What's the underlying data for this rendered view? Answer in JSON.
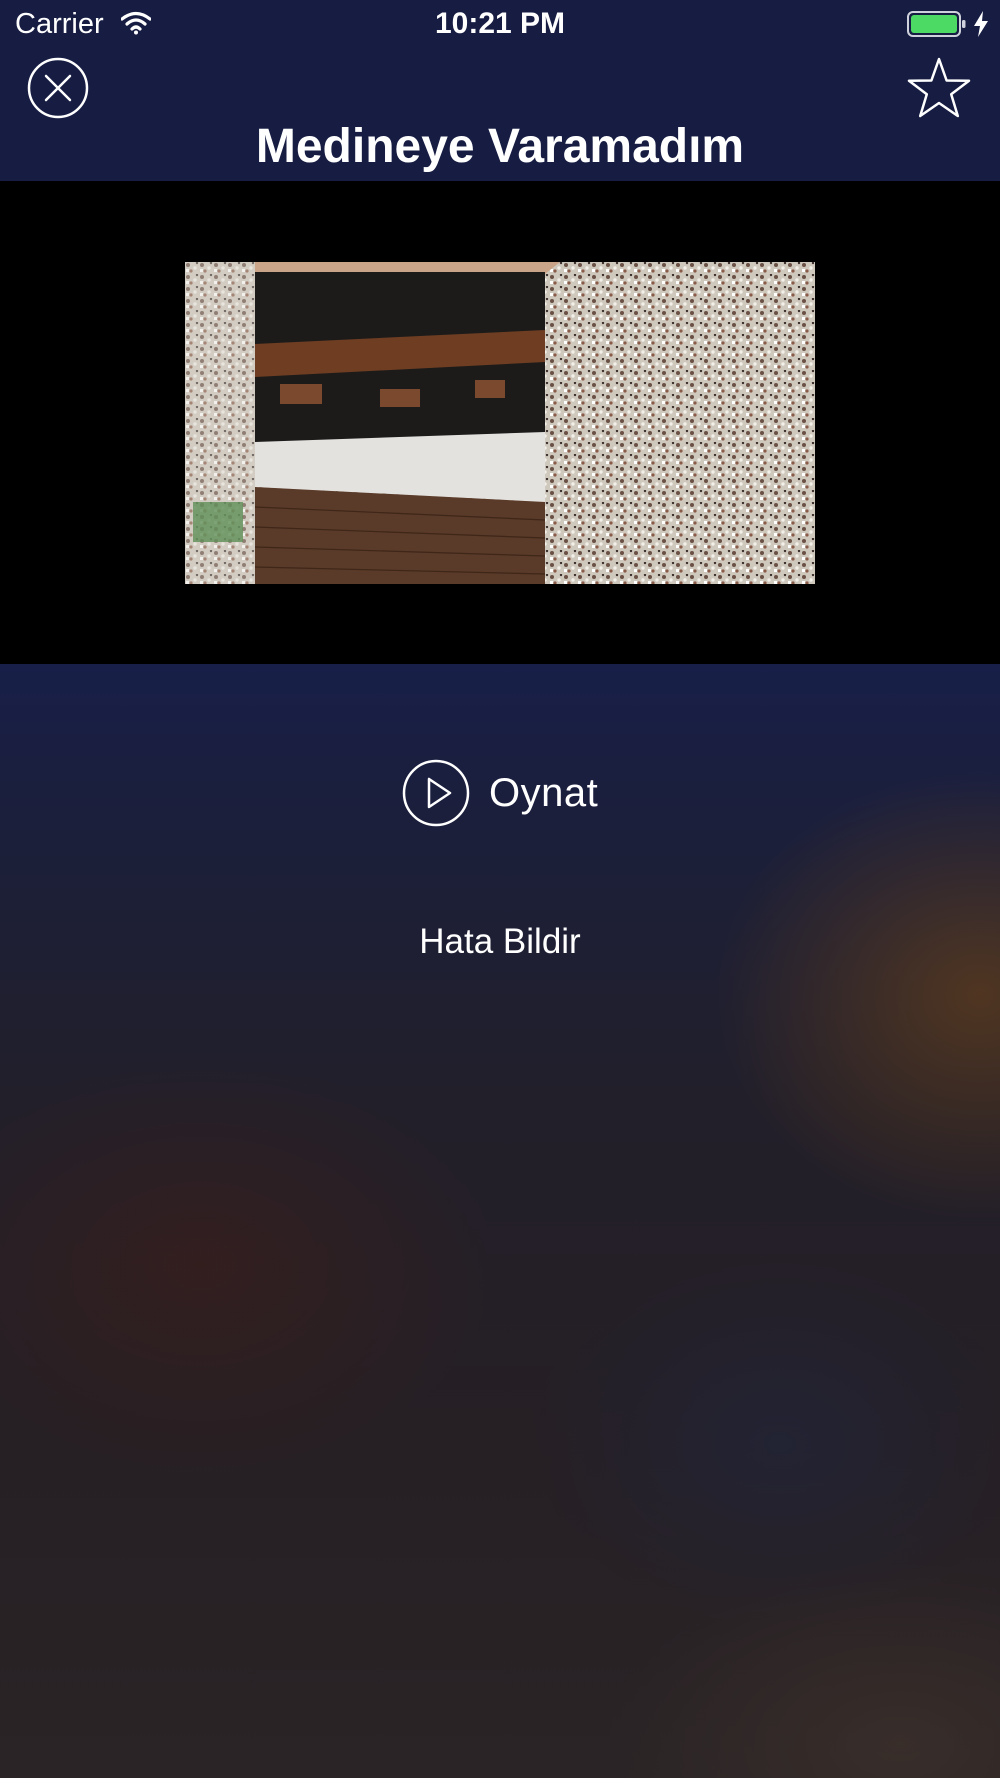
{
  "status_bar": {
    "carrier": "Carrier",
    "time": "10:21 PM",
    "battery_color": "#4cd964"
  },
  "header": {
    "title": "Medineye Varamadım",
    "background": "#161c42",
    "left_icon": "close-icon",
    "right_icon": "star-icon"
  },
  "video": {
    "thumbnail_icon": "video-thumbnail"
  },
  "actions": {
    "play_label": "Oynat",
    "play_icon": "play-icon",
    "report_label": "Hata Bildir"
  }
}
